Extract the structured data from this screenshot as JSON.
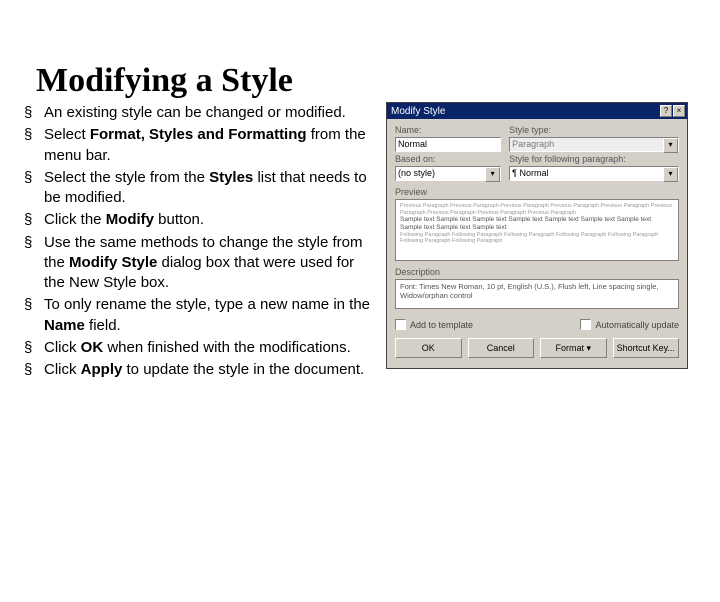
{
  "title": "Modifying a Style",
  "bullets": [
    {
      "pre": "An existing style can be changed or modified."
    },
    {
      "pre": "Select ",
      "b": "Format, Styles and Formatting",
      "post": " from the menu bar."
    },
    {
      "pre": "Select the style from the ",
      "b": "Styles",
      "post": " list that needs to be modified."
    },
    {
      "pre": "Click the ",
      "b": "Modify",
      "post": " button."
    },
    {
      "pre": "Use the same methods to change the style from the ",
      "b": "Modify Style",
      "post": " dialog box that were used for the New Style box."
    },
    {
      "pre": "To only rename the style, type a new name in the ",
      "b": "Name",
      "post": " field."
    },
    {
      "pre": "Click ",
      "b": "OK",
      "post": " when finished with the modifications."
    },
    {
      "pre": "Click ",
      "b": "Apply",
      "post": " to update the style in the document."
    }
  ],
  "dialog": {
    "title": "Modify Style",
    "help": "?",
    "close": "×",
    "name_lbl": "Name:",
    "name_val": "Normal",
    "type_lbl": "Style type:",
    "type_val": "Paragraph",
    "based_lbl": "Based on:",
    "based_val": "(no style)",
    "follow_lbl": "Style for following paragraph:",
    "follow_val": "¶ Normal",
    "preview_lbl": "Preview",
    "desc_lbl": "Description",
    "desc_val": "Font: Times New Roman, 10 pt, English (U.S.), Flush left, Line spacing single, Widow/orphan control",
    "chk1": "Add to template",
    "chk2": "Automatically update",
    "ok": "OK",
    "cancel": "Cancel",
    "format": "Format ▾",
    "shortcut": "Shortcut Key..."
  }
}
